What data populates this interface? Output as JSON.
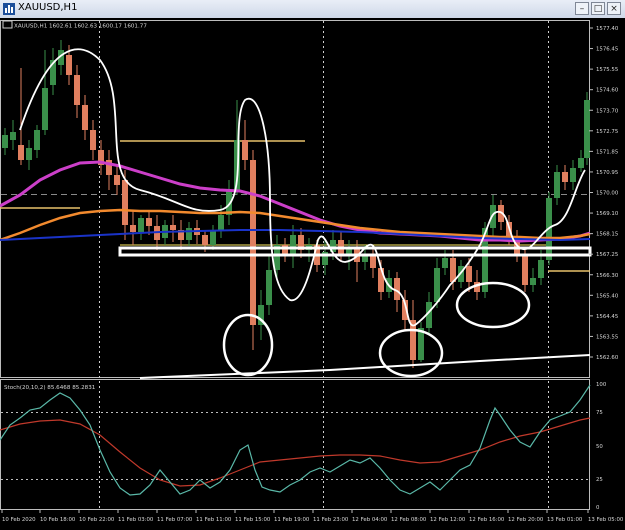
{
  "window": {
    "title": "XAUUSD,H1",
    "buttons": [
      "–",
      "□",
      "×"
    ]
  },
  "main_header": "XAUUSD,H1  1602.61 1602.63 1600.17 1601.77",
  "price_axis": [
    "1577.40",
    "1576.45",
    "1575.55",
    "1574.60",
    "1573.70",
    "1572.75",
    "1571.85",
    "1570.95",
    "1570.00",
    "1569.10",
    "1568.15",
    "1567.25",
    "1566.30",
    "1565.40",
    "1564.45",
    "1563.55",
    "1562.60"
  ],
  "time_axis": [
    "10 Feb 2020",
    "10 Feb 18:00",
    "10 Feb 22:00",
    "11 Feb 03:00",
    "11 Feb 07:00",
    "11 Feb 11:00",
    "11 Feb 15:00",
    "11 Feb 19:00",
    "11 Feb 23:00",
    "12 Feb 04:00",
    "12 Feb 08:00",
    "12 Feb 12:00",
    "12 Feb 16:00",
    "12 Feb 20:00",
    "13 Feb 01:00",
    "13 Feb 05:00"
  ],
  "stoch_header": "Stoch(20,10,2) 85.6468 85.2831",
  "stoch_axis": [
    "100",
    "75",
    "50",
    "25",
    "0"
  ],
  "colors": {
    "bull": "#3a8f4a",
    "bear": "#e07f5f",
    "ma_magenta": "#cc3fc9",
    "ma_orange": "#f28a2e",
    "ma_blue": "#1a33c8",
    "stoch_main": "#5ab8a8",
    "stoch_signal": "#c0392b"
  }
}
